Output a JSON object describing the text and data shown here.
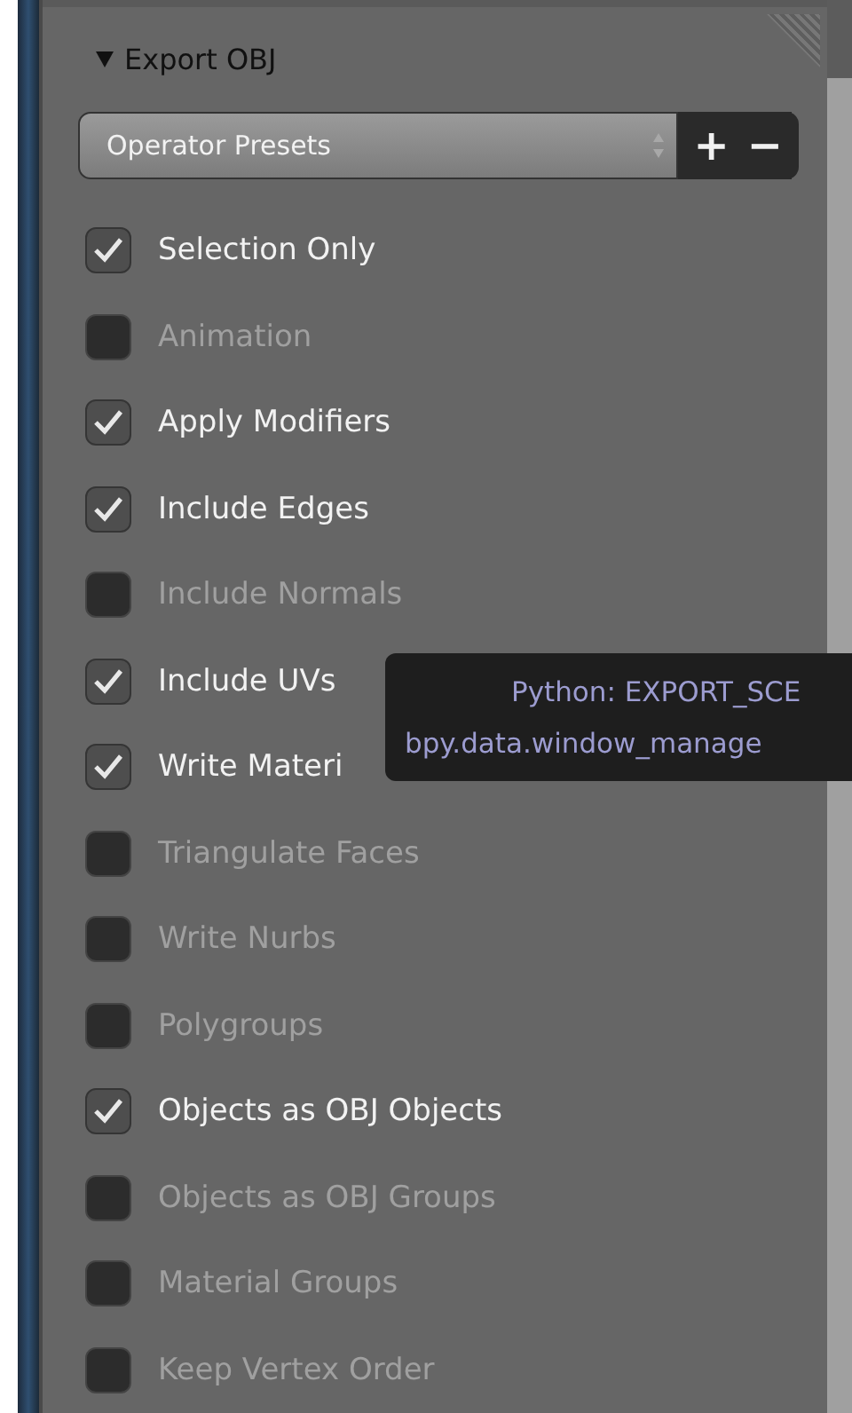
{
  "panel": {
    "title": "Export OBJ",
    "expanded": true
  },
  "presets": {
    "label": "Operator Presets",
    "add": "+",
    "remove": "−"
  },
  "options": [
    {
      "label": "Selection Only",
      "checked": true
    },
    {
      "label": "Animation",
      "checked": false
    },
    {
      "label": "Apply Modifiers",
      "checked": true
    },
    {
      "label": "Include Edges",
      "checked": true
    },
    {
      "label": "Include Normals",
      "checked": false
    },
    {
      "label": "Include UVs",
      "checked": true
    },
    {
      "label": "Write Materi",
      "checked": true
    },
    {
      "label": "Triangulate Faces",
      "checked": false
    },
    {
      "label": "Write Nurbs",
      "checked": false
    },
    {
      "label": "Polygroups",
      "checked": false
    },
    {
      "label": "Objects as OBJ Objects",
      "checked": true
    },
    {
      "label": "Objects as OBJ Groups",
      "checked": false
    },
    {
      "label": "Material Groups",
      "checked": false
    },
    {
      "label": "Keep Vertex Order",
      "checked": false
    }
  ],
  "tooltip": {
    "lines": [
      "Python: EXPORT_SCE",
      "bpy.data.window_manage"
    ]
  }
}
